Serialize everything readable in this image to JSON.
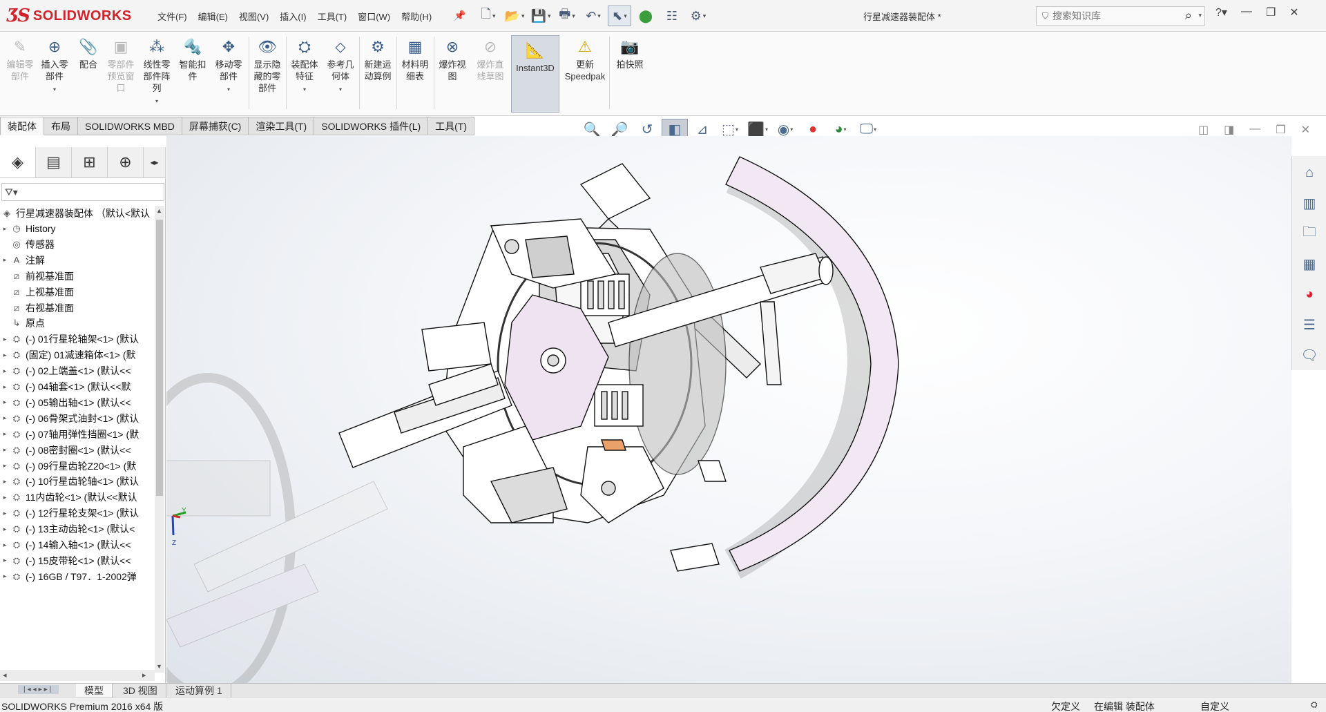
{
  "app": {
    "logo_ds": "ƷS",
    "logo_name": "SOLIDWORKS",
    "document_title": "行星减速器装配体 *"
  },
  "menu": [
    "文件(F)",
    "编辑(E)",
    "视图(V)",
    "插入(I)",
    "工具(T)",
    "窗口(W)",
    "帮助(H)"
  ],
  "search": {
    "placeholder": "搜索知识库"
  },
  "commands": [
    {
      "label": "编辑零\n部件",
      "icon": "edit-component-icon",
      "disabled": true
    },
    {
      "label": "插入零\n部件",
      "icon": "insert-components-icon",
      "disabled": false
    },
    {
      "label": "配合",
      "icon": "mate-icon",
      "disabled": false
    },
    {
      "label": "零部件\n预览窗\n口",
      "icon": "component-preview-icon",
      "disabled": true
    },
    {
      "label": "线性零\n部件阵\n列",
      "icon": "linear-pattern-icon",
      "disabled": false
    },
    {
      "label": "智能扣\n件",
      "icon": "smart-fasteners-icon",
      "disabled": false
    },
    {
      "label": "移动零\n部件",
      "icon": "move-component-icon",
      "disabled": false
    },
    {
      "label": "显示隐\n藏的零\n部件",
      "icon": "show-hidden-icon",
      "disabled": false
    },
    {
      "label": "装配体\n特征",
      "icon": "assembly-features-icon",
      "disabled": false
    },
    {
      "label": "参考几\n何体",
      "icon": "reference-geometry-icon",
      "disabled": false
    },
    {
      "label": "新建运\n动算例",
      "icon": "motion-study-icon",
      "disabled": false
    },
    {
      "label": "材料明\n细表",
      "icon": "bom-icon",
      "disabled": false
    },
    {
      "label": "爆炸视\n图",
      "icon": "exploded-view-icon",
      "disabled": false
    },
    {
      "label": "爆炸直\n线草图",
      "icon": "explode-line-sketch-icon",
      "disabled": true
    },
    {
      "label": "Instant3D",
      "icon": "instant3d-icon",
      "disabled": false
    },
    {
      "label": "更新\nSpeedpak",
      "icon": "speedpak-icon",
      "disabled": false
    },
    {
      "label": "拍快照",
      "icon": "snapshot-icon",
      "disabled": false
    }
  ],
  "tabs": [
    "装配体",
    "布局",
    "SOLIDWORKS MBD",
    "屏幕捕获(C)",
    "渲染工具(T)",
    "SOLIDWORKS 插件(L)",
    "工具(T)"
  ],
  "feature_tree": {
    "root": "行星减速器装配体 （默认<默认",
    "items": [
      {
        "label": "History",
        "icon": "history-icon",
        "expandable": true
      },
      {
        "label": "传感器",
        "icon": "sensor-icon",
        "expandable": false
      },
      {
        "label": "注解",
        "icon": "annotation-icon",
        "expandable": true
      },
      {
        "label": "前视基准面",
        "icon": "plane-icon",
        "expandable": false
      },
      {
        "label": "上视基准面",
        "icon": "plane-icon",
        "expandable": false
      },
      {
        "label": "右视基准面",
        "icon": "plane-icon",
        "expandable": false
      },
      {
        "label": "原点",
        "icon": "origin-icon",
        "expandable": false
      },
      {
        "label": "(-) 01行星轮轴架<1> (默认",
        "icon": "part-icon",
        "expandable": true
      },
      {
        "label": "(固定) 01减速箱体<1> (默",
        "icon": "part-icon",
        "expandable": true
      },
      {
        "label": "(-) 02上端盖<1> (默认<<",
        "icon": "part-icon",
        "expandable": true
      },
      {
        "label": "(-) 04轴套<1> (默认<<默",
        "icon": "part-icon",
        "expandable": true
      },
      {
        "label": "(-) 05输出轴<1> (默认<<",
        "icon": "part-icon",
        "expandable": true
      },
      {
        "label": "(-) 06骨架式油封<1> (默认",
        "icon": "part-icon",
        "expandable": true
      },
      {
        "label": "(-) 07轴用弹性挡圈<1> (默",
        "icon": "part-icon",
        "expandable": true
      },
      {
        "label": "(-) 08密封圈<1> (默认<<",
        "icon": "part-icon",
        "expandable": true
      },
      {
        "label": "(-) 09行星齿轮Z20<1> (默",
        "icon": "part-icon",
        "expandable": true
      },
      {
        "label": "(-) 10行星齿轮轴<1> (默认",
        "icon": "part-icon",
        "expandable": true
      },
      {
        "label": "11内齿轮<1> (默认<<默认",
        "icon": "part-icon",
        "expandable": true
      },
      {
        "label": "(-) 12行星轮支架<1> (默认",
        "icon": "part-icon",
        "expandable": true
      },
      {
        "label": "(-) 13主动齿轮<1> (默认<",
        "icon": "part-icon",
        "expandable": true
      },
      {
        "label": "(-) 14输入轴<1> (默认<<",
        "icon": "part-icon",
        "expandable": true
      },
      {
        "label": "(-) 15皮带轮<1> (默认<<",
        "icon": "part-icon",
        "expandable": true
      },
      {
        "label": "(-) 16GB / T97．1-2002弹",
        "icon": "part-icon",
        "expandable": true
      }
    ]
  },
  "bottom_tabs": [
    "模型",
    "3D 视图",
    "运动算例 1"
  ],
  "status": {
    "product": "SOLIDWORKS Premium 2016 x64 版",
    "definition": "欠定义",
    "mode": "在编辑 装配体",
    "units": "自定义"
  },
  "triad": {
    "y": "Y",
    "z": "Z"
  }
}
